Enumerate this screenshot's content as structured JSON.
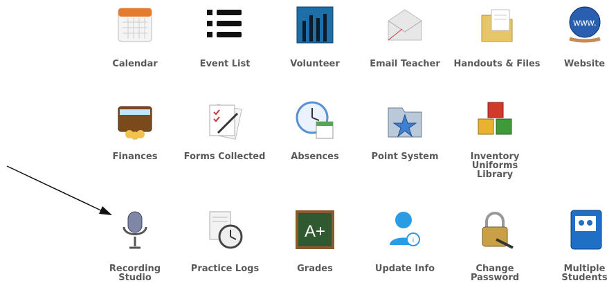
{
  "tiles": [
    {
      "label": "Calendar",
      "icon": "calendar-icon"
    },
    {
      "label": "Event List",
      "icon": "list-icon"
    },
    {
      "label": "Volunteer",
      "icon": "raised-hands-icon"
    },
    {
      "label": "Email Teacher",
      "icon": "envelope-icon"
    },
    {
      "label": "Handouts & Files",
      "icon": "folder-files-icon"
    },
    {
      "label": "Website",
      "icon": "globe-www-icon"
    },
    {
      "label": "Finances",
      "icon": "wallet-icon"
    },
    {
      "label": "Forms Collected",
      "icon": "checklist-forms-icon"
    },
    {
      "label": "Absences",
      "icon": "clock-calendar-icon"
    },
    {
      "label": "Point System",
      "icon": "star-folder-icon"
    },
    {
      "label": "Inventory\nUniforms\nLibrary",
      "icon": "boxes-icon"
    },
    {
      "label": "Recording\nStudio",
      "icon": "microphone-icon"
    },
    {
      "label": "Practice Logs",
      "icon": "stopwatch-document-icon"
    },
    {
      "label": "Grades",
      "icon": "chalkboard-a-plus-icon"
    },
    {
      "label": "Update Info",
      "icon": "user-info-icon"
    },
    {
      "label": "Change\nPassword",
      "icon": "padlock-key-icon"
    },
    {
      "label": "Multiple\nStudents",
      "icon": "group-book-icon"
    }
  ],
  "annotation": {
    "icon": "arrow-pointer-icon"
  }
}
